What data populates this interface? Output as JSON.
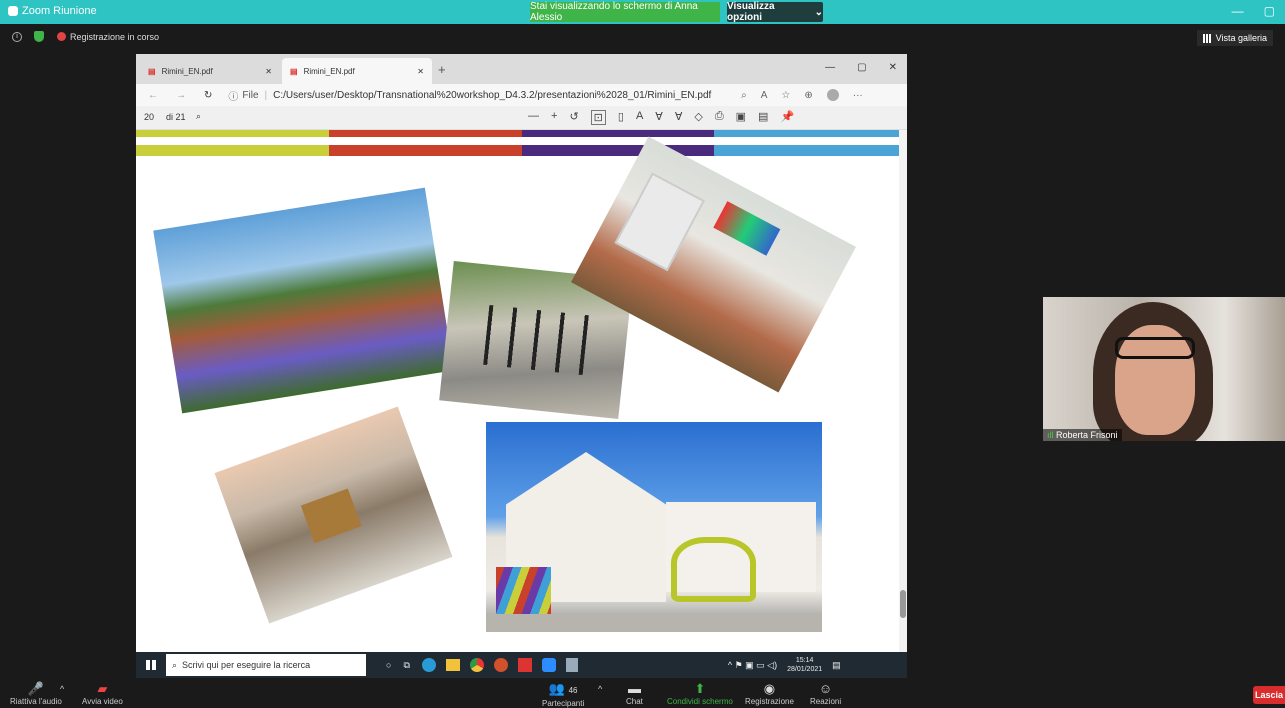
{
  "zoom": {
    "window_title": "Zoom Riunione",
    "share_banner": "Stai visualizzando lo schermo di Anna Alessio",
    "view_options": "Visualizza opzioni",
    "recording": "Registrazione in corso",
    "gallery": "Vista galleria",
    "participant_name": "Roberta Frisoni",
    "leave": "Lascia",
    "bottom": {
      "audio": "Riattiva l'audio",
      "video": "Avvia video",
      "participants": "Partecipanti",
      "participant_count": "46",
      "chat": "Chat",
      "share": "Condividi schermo",
      "record": "Registrazione",
      "reactions": "Reazioni"
    }
  },
  "browser": {
    "tab1": "Rimini_EN.pdf",
    "tab2": "Rimini_EN.pdf",
    "address_prefix": "File",
    "url": "C:/Users/user/Desktop/Transnational%20workshop_D4.3.2/presentazioni%2028_01/Rimini_EN.pdf",
    "page_current": "20",
    "page_total": "di 21"
  },
  "taskbar": {
    "search_placeholder": "Scrivi qui per eseguire la ricerca",
    "time": "15:14",
    "date": "28/01/2021"
  },
  "colors": {
    "stripe": [
      "#c9cf3a",
      "#c9412b",
      "#4a2a7c",
      "#4aa4d6"
    ],
    "accent_green": "#3fb549",
    "teal": "#2ec4c4"
  }
}
